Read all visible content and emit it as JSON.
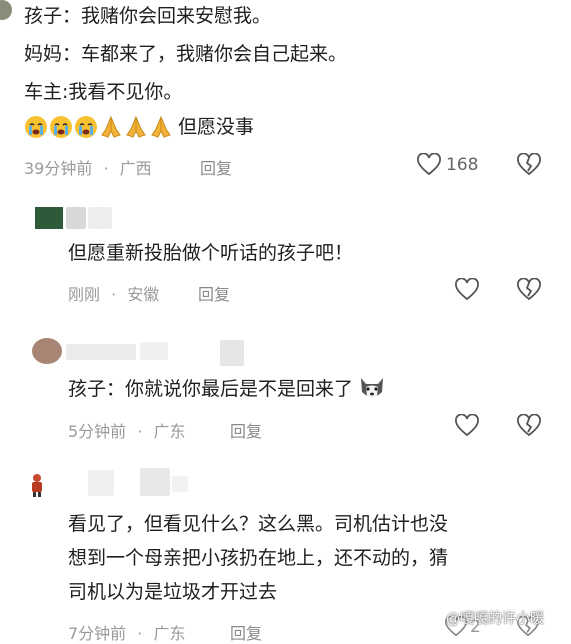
{
  "comment1": {
    "lines": [
      "孩子：我赌你会回来安慰我。",
      "妈妈：车都来了，我赌你会自己起来。",
      "车主:我看不见你。",
      "但愿没事"
    ],
    "emojis": [
      "crying-face",
      "crying-face",
      "crying-face",
      "praying-hands",
      "praying-hands",
      "praying-hands"
    ],
    "time": "39分钟前",
    "location": "广西",
    "reply": "回复",
    "likes": "168"
  },
  "comment2": {
    "text": "但愿重新投胎做个听话的孩子吧！",
    "time": "刚刚",
    "location": "安徽",
    "reply": "回复"
  },
  "comment3": {
    "text": "孩子：你就说你最后是不是回来了",
    "emoji": "husky-dog",
    "time": "5分钟前",
    "location": "广东",
    "reply": "回复"
  },
  "comment4": {
    "lines": [
      "看见了，但看见什么？这么黑。司机估计也没",
      "想到一个母亲把小孩扔在地上，还不动的，猜",
      "司机以为是垃圾才开过去"
    ],
    "time": "7分钟前",
    "location": "广东",
    "reply": "回复",
    "likes": "2"
  },
  "watermark": "@嘎嘎的许小暖",
  "separator": "·",
  "colors": {
    "text": "#1f1f1f",
    "meta": "#9a9a9a"
  }
}
